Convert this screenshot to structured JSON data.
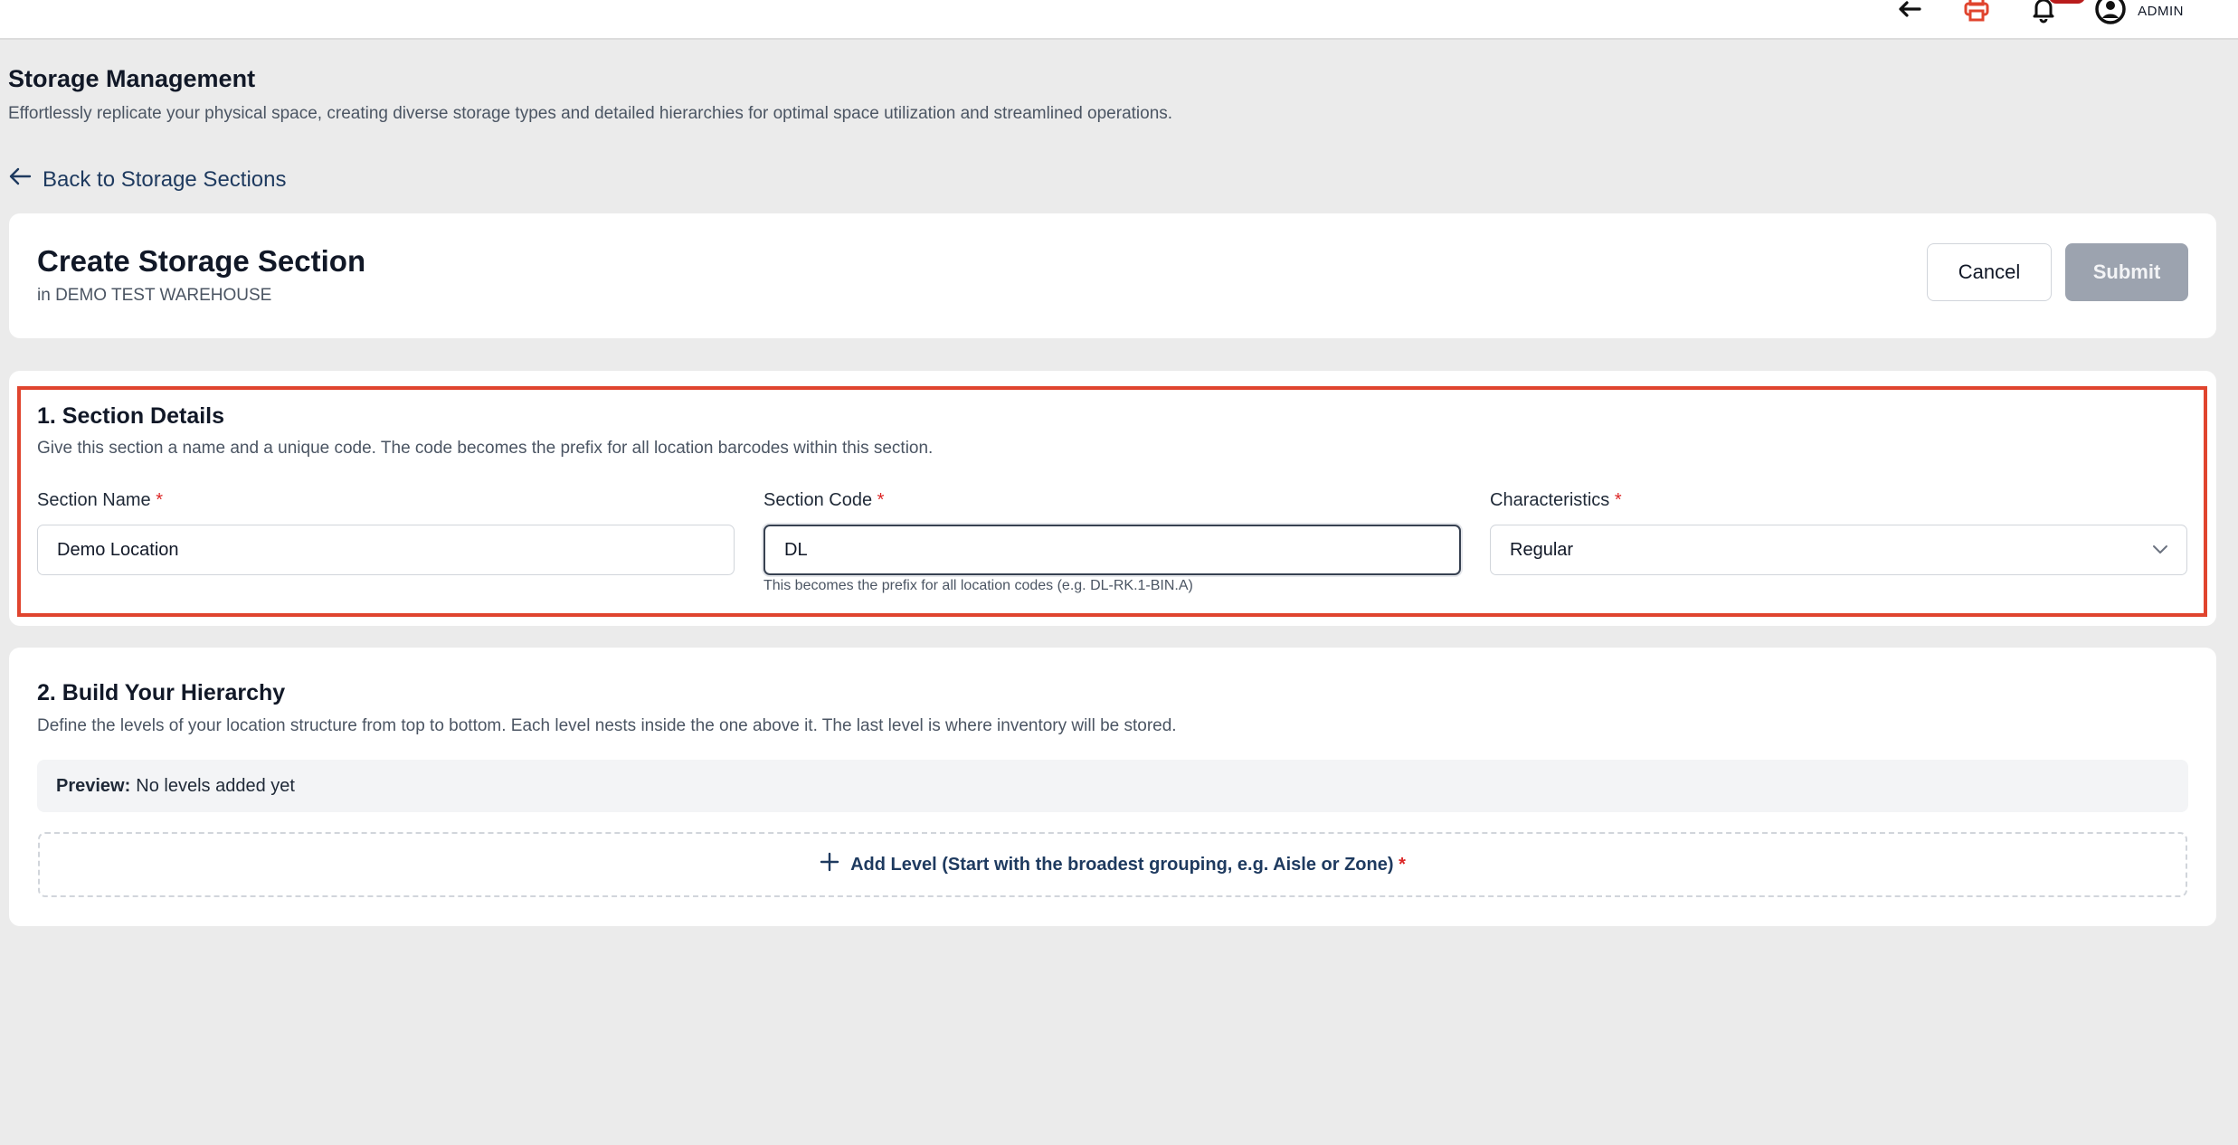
{
  "topbar": {
    "icons": [
      "back-arrow-icon",
      "print-icon",
      "bell-icon",
      "user-circle-icon"
    ],
    "user_label": "ADMIN",
    "accent_colors": {
      "print": "#e0442e",
      "badge": "#b91c1c"
    }
  },
  "page": {
    "title": "Storage Management",
    "subtitle": "Effortlessly replicate your physical space, creating diverse storage types and detailed hierarchies for optimal space utilization and streamlined operations."
  },
  "back_link": {
    "label": "Back to Storage Sections",
    "icon": "arrow-left-icon"
  },
  "create_card": {
    "title": "Create Storage Section",
    "subtitle": "in DEMO TEST WAREHOUSE",
    "cancel_label": "Cancel",
    "submit_label": "Submit"
  },
  "section_details": {
    "title": "1. Section Details",
    "description": "Give this section a name and a unique code. The code becomes the prefix for all location barcodes within this section.",
    "fields": {
      "section_name": {
        "label": "Section Name",
        "required_mark": "*",
        "value": "Demo Location"
      },
      "section_code": {
        "label": "Section Code",
        "required_mark": "*",
        "value": "DL",
        "help": "This becomes the prefix for all location codes (e.g. DL-RK.1-BIN.A)"
      },
      "characteristics": {
        "label": "Characteristics",
        "required_mark": "*",
        "value": "Regular",
        "icon": "chevron-down-icon"
      }
    },
    "highlight_color": "#e0442e"
  },
  "hierarchy": {
    "title": "2. Build Your Hierarchy",
    "description": "Define the levels of your location structure from top to bottom. Each level nests inside the one above it. The last level is where inventory will be stored.",
    "preview_label": "Preview:",
    "preview_value": "No levels added yet",
    "add_level_label": "Add Level (Start with the broadest grouping, e.g. Aisle or Zone)",
    "add_level_required": "*",
    "add_icon": "plus-icon"
  }
}
